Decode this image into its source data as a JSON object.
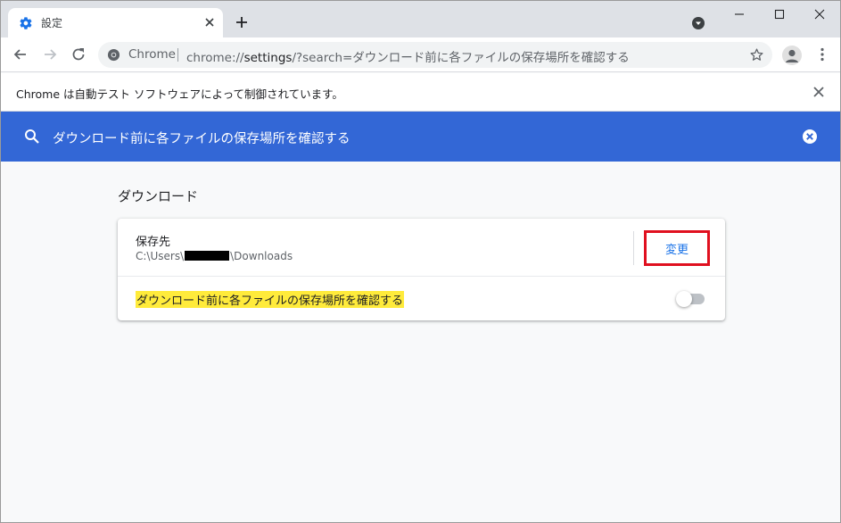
{
  "tab": {
    "title": "設定",
    "favicon": "gear-icon",
    "close_icon": "close-icon"
  },
  "toolbar": {
    "omnibox_chip": "Chrome",
    "url_prefix": "chrome://",
    "url_host": "settings",
    "url_rest": "/?search=ダウンロード前に各ファイルの保存場所を確認する"
  },
  "infobar": {
    "message": "Chrome は自動テスト ソフトウェアによって制御されています。"
  },
  "search": {
    "query": "ダウンロード前に各ファイルの保存場所を確認する"
  },
  "downloads": {
    "section_title": "ダウンロード",
    "location_label": "保存先",
    "location_prefix": "C:\\Users\\",
    "location_suffix": "\\Downloads",
    "change_button": "変更",
    "ask_label": "ダウンロード前に各ファイルの保存場所を確認する",
    "ask_enabled": false
  },
  "colors": {
    "accent_blue": "#3367d6",
    "link_blue": "#1a73e8",
    "highlight_yellow": "#ffeb3b",
    "annotation_red": "#e0101f"
  }
}
